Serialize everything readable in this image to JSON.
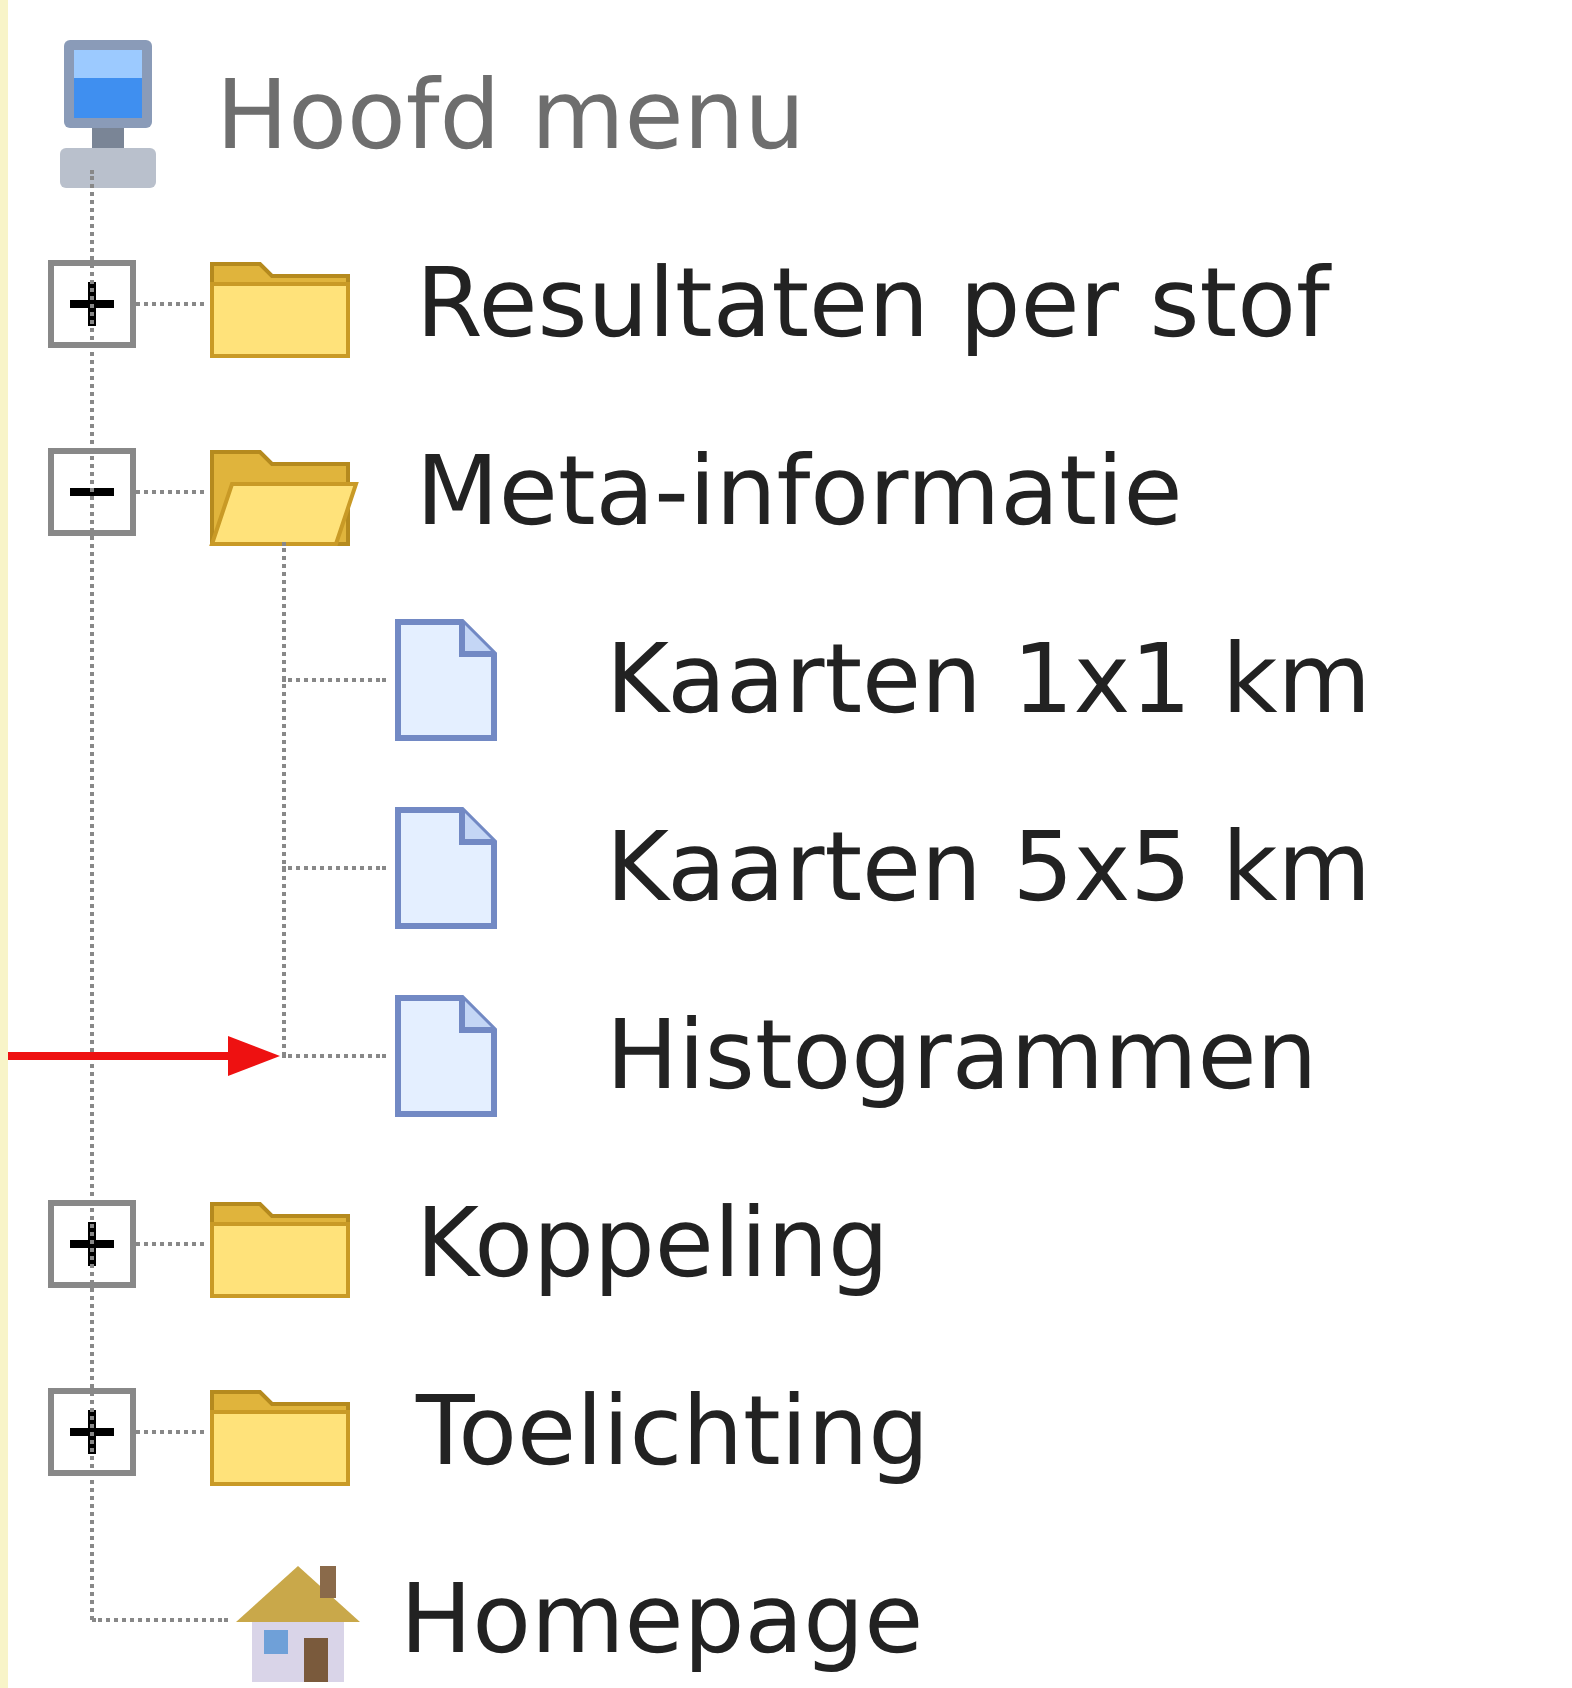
{
  "root": {
    "label": "Hoofd menu"
  },
  "items": [
    {
      "kind": "folder",
      "label": "Resultaten per stof",
      "expanded": false
    },
    {
      "kind": "folder",
      "label": "Meta-informatie",
      "expanded": true,
      "children": [
        {
          "kind": "document",
          "label": "Kaarten 1x1 km",
          "marked": false
        },
        {
          "kind": "document",
          "label": "Kaarten 5x5 km",
          "marked": false
        },
        {
          "kind": "document",
          "label": "Histogrammen",
          "marked": true
        }
      ]
    },
    {
      "kind": "folder",
      "label": "Koppeling",
      "expanded": false
    },
    {
      "kind": "folder",
      "label": "Toelichting",
      "expanded": false
    },
    {
      "kind": "home",
      "label": "Homepage"
    }
  ]
}
